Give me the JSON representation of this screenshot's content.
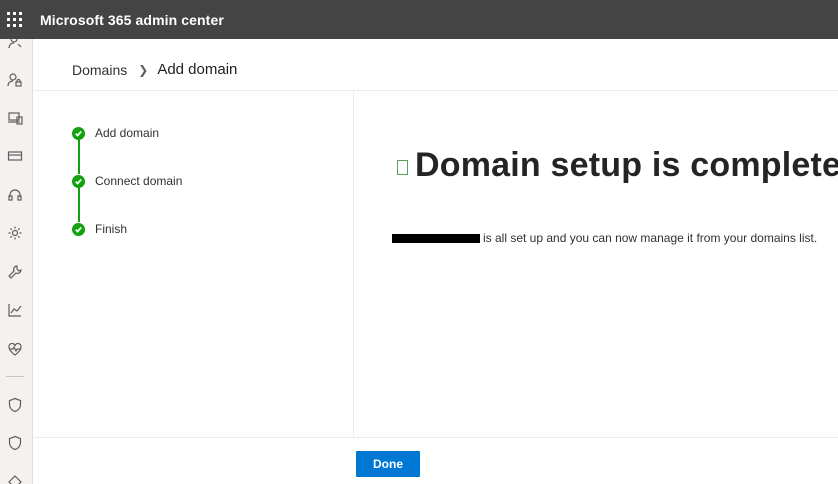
{
  "topbar": {
    "app_title": "Microsoft 365 admin center"
  },
  "leftnav": {
    "icons": [
      "user-partial-icon",
      "user-lock-icon",
      "devices-icon",
      "billing-card-icon",
      "headset-support-icon",
      "settings-gear-icon",
      "wrench-setup-icon",
      "reports-chart-icon",
      "health-heart-icon",
      "shield-security-icon",
      "shield-compliance-icon",
      "more-partial-icon"
    ]
  },
  "breadcrumb": {
    "parent": "Domains",
    "current": "Add domain"
  },
  "steps": [
    {
      "label": "Add domain",
      "status": "complete"
    },
    {
      "label": "Connect domain",
      "status": "complete"
    },
    {
      "label": "Finish",
      "status": "complete"
    }
  ],
  "main": {
    "title": "Domain setup is complete",
    "message": "is all set up and you can now manage it from your domains list."
  },
  "footer": {
    "done_label": "Done"
  },
  "colors": {
    "topbar": "#444444",
    "step_complete": "#13a10e",
    "primary_button": "#0078d4"
  }
}
